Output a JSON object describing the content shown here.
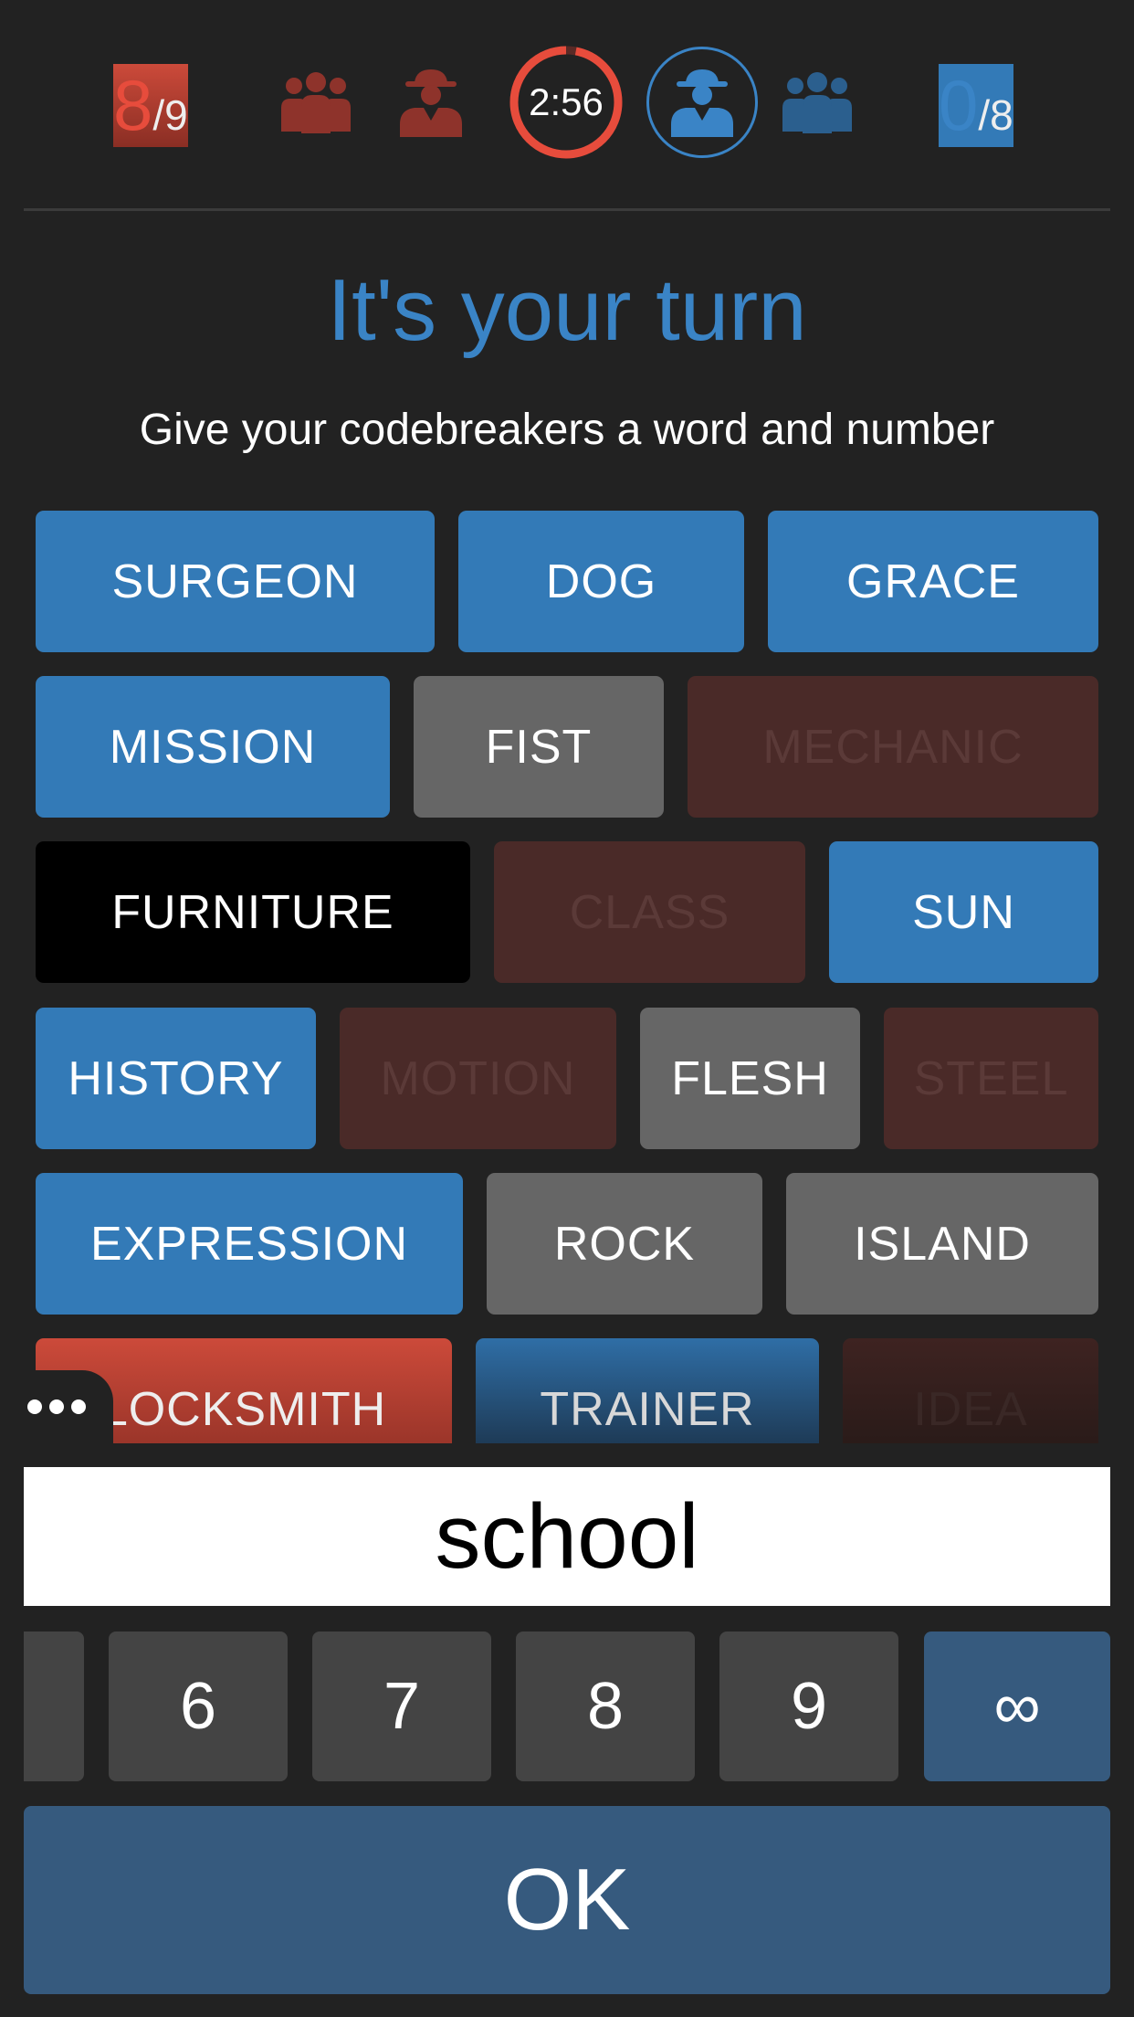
{
  "score": {
    "red": {
      "count": "8",
      "total": "/9"
    },
    "blue": {
      "count": "0",
      "total": "/8"
    }
  },
  "timer": {
    "text": "2:56",
    "remaining_fraction": 0.97
  },
  "icons": {
    "red_team": "team-icon",
    "red_spymaster": "spymaster-icon",
    "blue_spymaster": "spymaster-icon",
    "blue_team": "team-icon"
  },
  "status": {
    "title": "It's your turn",
    "subtitle": "Give your codebreakers a word and number"
  },
  "cards": [
    {
      "word": "SURGEON",
      "color": "blue"
    },
    {
      "word": "DOG",
      "color": "blue"
    },
    {
      "word": "GRACE",
      "color": "blue"
    },
    {
      "word": "MISSION",
      "color": "blue"
    },
    {
      "word": "FIST",
      "color": "neutral"
    },
    {
      "word": "MECHANIC",
      "color": "red-revealed"
    },
    {
      "word": "FURNITURE",
      "color": "assassin"
    },
    {
      "word": "CLASS",
      "color": "red-revealed"
    },
    {
      "word": "SUN",
      "color": "blue"
    },
    {
      "word": "HISTORY",
      "color": "blue"
    },
    {
      "word": "MOTION",
      "color": "red-revealed"
    },
    {
      "word": "FLESH",
      "color": "neutral"
    },
    {
      "word": "STEEL",
      "color": "red-revealed"
    },
    {
      "word": "EXPRESSION",
      "color": "blue"
    },
    {
      "word": "ROCK",
      "color": "neutral"
    },
    {
      "word": "ISLAND",
      "color": "neutral"
    },
    {
      "word": "LOCKSMITH",
      "color": "red"
    },
    {
      "word": "TRAINER",
      "color": "blue"
    },
    {
      "word": "IDEA",
      "color": "red-revealed"
    }
  ],
  "clue": {
    "value": "school"
  },
  "numbers": [
    "6",
    "7",
    "8",
    "9",
    "∞"
  ],
  "ok_label": "OK",
  "colors": {
    "red": "#e74c3c",
    "blue": "#337ab7",
    "neutral": "#666666",
    "assassin": "#000000",
    "background": "#222222",
    "button": "#365a7e"
  }
}
